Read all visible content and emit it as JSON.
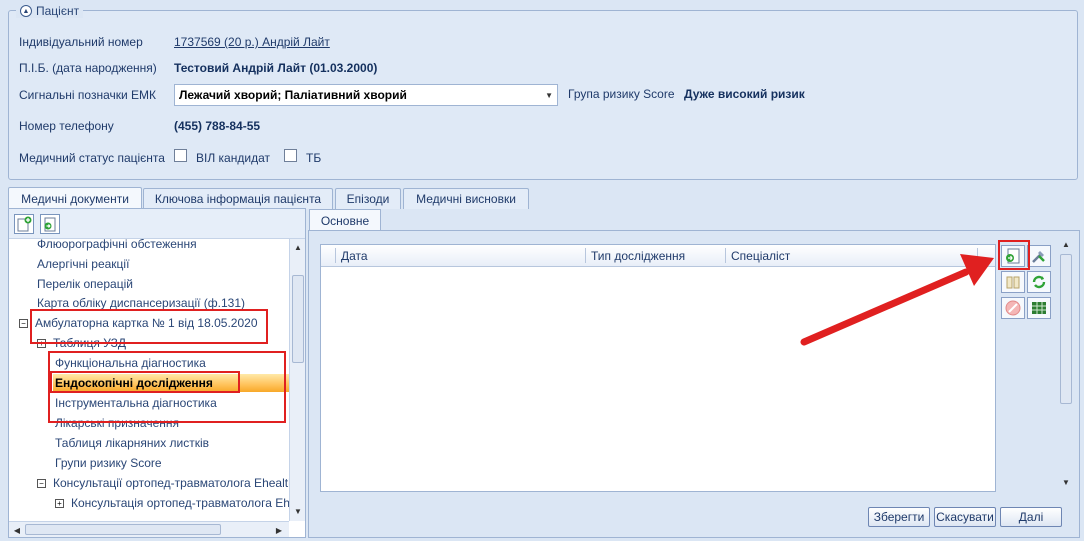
{
  "patient": {
    "section_title": "Пацієнт",
    "fields": {
      "id_label": "Індивідуальний номер",
      "id_value": "1737569 (20 р.) Андрій Лайт",
      "name_label": "П.І.Б. (дата народження)",
      "name_value": "Тестовий Андрій Лайт (01.03.2000)",
      "signals_label": "Сигнальні позначки ЕМК",
      "signals_value": "Лежачий хворий; Паліативний хворий",
      "risk_label": "Група ризику Score",
      "risk_value": "Дуже високий ризик",
      "phone_label": "Номер телефону",
      "phone_value": "(455) 788-84-55",
      "status_label": "Медичний статус пацієнта",
      "hiv_label": "ВІЛ кандидат",
      "tb_label": "ТБ"
    }
  },
  "tabs": [
    {
      "label": "Медичні документи"
    },
    {
      "label": "Ключова інформація пацієнта"
    },
    {
      "label": "Епізоди"
    },
    {
      "label": "Медичні висновки"
    }
  ],
  "tree": {
    "items": [
      {
        "label": "Флюорографічні обстеження"
      },
      {
        "label": "Алергічні реакції"
      },
      {
        "label": "Перелік операцій"
      },
      {
        "label": "Карта обліку диспансеризації (ф.131)"
      },
      {
        "label": "Амбулаторна картка № 1 від 18.05.2020",
        "expander": "−"
      },
      {
        "label": "Таблиця УЗД",
        "expander": "+"
      },
      {
        "label": "Функціональна діагностика"
      },
      {
        "label": "Ендоскопічні дослідження"
      },
      {
        "label": "Інструментальна діагностика"
      },
      {
        "label": "Лікарські призначення"
      },
      {
        "label": "Таблиця лікарняних листків"
      },
      {
        "label": "Групи ризику Score"
      },
      {
        "label": "Консультації ортопед-травматолога Ehealth",
        "expander": "−"
      },
      {
        "label": "Консультація ортопед-травматолога Ehealth",
        "expander": "+"
      }
    ]
  },
  "right": {
    "subtab": "Основне",
    "columns": [
      "Дата",
      "Тип дослідження",
      "Спеціаліст"
    ]
  },
  "buttons": {
    "save": "Зберегти",
    "cancel": "Скасувати",
    "next": "Далі"
  },
  "colors": {
    "highlight_red": "#e02020",
    "selection": "#ffc25a",
    "accent": "#1f3a6a"
  }
}
